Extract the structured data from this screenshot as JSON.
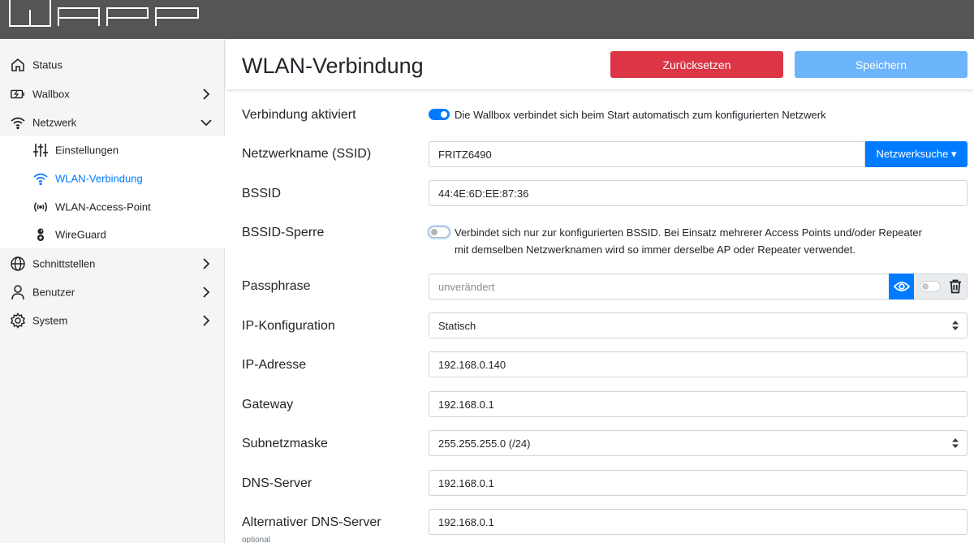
{
  "sidebar": {
    "items": [
      {
        "label": "Status",
        "icon": "home-icon"
      },
      {
        "label": "Wallbox",
        "icon": "charger-icon"
      },
      {
        "label": "Netzwerk",
        "icon": "wifi-icon"
      },
      {
        "label": "Einstellungen",
        "icon": "sliders-icon"
      },
      {
        "label": "WLAN-Verbindung",
        "icon": "wifi-icon"
      },
      {
        "label": "WLAN-Access-Point",
        "icon": "access-point-icon"
      },
      {
        "label": "WireGuard",
        "icon": "wireguard-icon"
      },
      {
        "label": "Schnittstellen",
        "icon": "globe-icon"
      },
      {
        "label": "Benutzer",
        "icon": "user-icon"
      },
      {
        "label": "System",
        "icon": "gear-icon"
      }
    ]
  },
  "header": {
    "title": "WLAN-Verbindung",
    "reset_label": "Zurücksetzen",
    "save_label": "Speichern"
  },
  "form": {
    "enabled": {
      "label": "Verbindung aktiviert",
      "text": "Die Wallbox verbindet sich beim Start automatisch zum konfigurierten Netzwerk",
      "on": true
    },
    "ssid": {
      "label": "Netzwerkname (SSID)",
      "value": "FRITZ6490",
      "button": "Netzwerksuche ▾"
    },
    "bssid": {
      "label": "BSSID",
      "value": "44:4E:6D:EE:87:36"
    },
    "bssid_lock": {
      "label": "BSSID-Sperre",
      "text_line1": "Verbindet sich nur zur konfigurierten BSSID. Bei Einsatz mehrerer Access Points und/oder Repeater",
      "text_line2": "mit demselben Netzwerknamen wird so immer derselbe AP oder Repeater verwendet.",
      "on": false
    },
    "passphrase": {
      "label": "Passphrase",
      "placeholder": "unverändert"
    },
    "ip_config": {
      "label": "IP-Konfiguration",
      "value": "Statisch"
    },
    "ip_address": {
      "label": "IP-Adresse",
      "value": "192.168.0.140"
    },
    "gateway": {
      "label": "Gateway",
      "value": "192.168.0.1"
    },
    "subnet": {
      "label": "Subnetzmaske",
      "value": "255.255.255.0 (/24)"
    },
    "dns": {
      "label": "DNS-Server",
      "value": "192.168.0.1"
    },
    "dns2": {
      "label": "Alternativer DNS-Server",
      "value": "192.168.0.1",
      "hint": "optional"
    }
  },
  "colors": {
    "accent": "#007bff",
    "danger": "#dc3545",
    "save": "#6cb4fc",
    "topbar": "#555555"
  }
}
